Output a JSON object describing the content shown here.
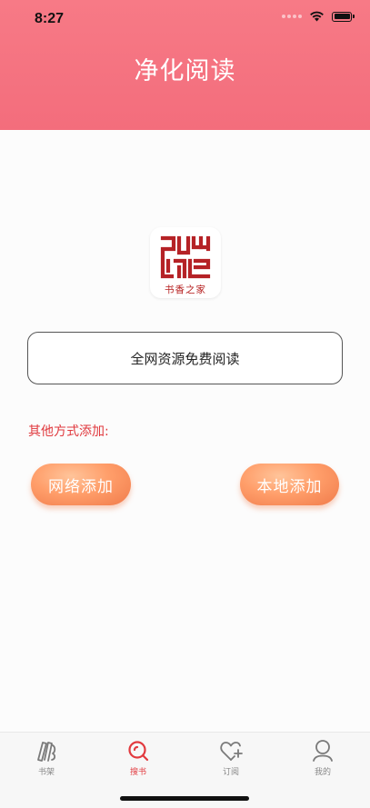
{
  "status_bar": {
    "time": "8:27"
  },
  "header": {
    "title": "净化阅读"
  },
  "logo": {
    "caption": "书香之家",
    "icon": "shuxiang-logo-icon"
  },
  "promo": {
    "text": "全网资源免费阅读"
  },
  "other_methods": {
    "label": "其他方式添加:",
    "buttons": [
      {
        "label": "网络添加"
      },
      {
        "label": "本地添加"
      }
    ]
  },
  "tabbar": {
    "items": [
      {
        "label": "书架",
        "icon": "bookshelf-icon",
        "active": false
      },
      {
        "label": "搜书",
        "icon": "search-icon",
        "active": true
      },
      {
        "label": "订阅",
        "icon": "heart-plus-icon",
        "active": false
      },
      {
        "label": "我的",
        "icon": "profile-icon",
        "active": false
      }
    ]
  },
  "colors": {
    "header": "#f36d7c",
    "accent_red": "#e23a3f",
    "button_orange": "#ff9e6a"
  }
}
